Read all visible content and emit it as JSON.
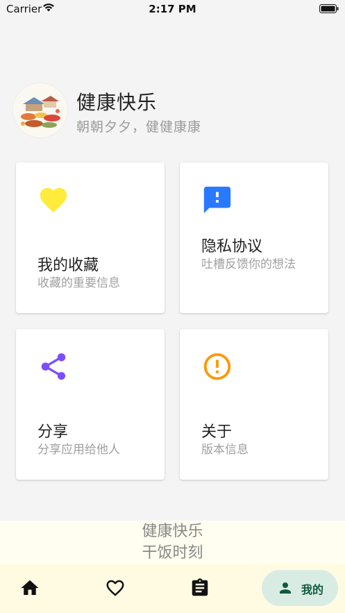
{
  "status_bar": {
    "carrier": "Carrier",
    "time": "2:17 PM"
  },
  "profile": {
    "name": "健康快乐",
    "subtitle": "朝朝夕夕，健健康康"
  },
  "cards": [
    {
      "title": "我的收藏",
      "desc": "收藏的重要信息",
      "icon": "heart-icon",
      "color": "#FFEB3B"
    },
    {
      "title": "隐私协议",
      "desc": "吐槽反馈你的想法",
      "icon": "feedback-icon",
      "color": "#2979FF"
    },
    {
      "title": "分享",
      "desc": "分享应用给他人",
      "icon": "share-icon",
      "color": "#7C4DFF"
    },
    {
      "title": "关于",
      "desc": "版本信息",
      "icon": "info-icon",
      "color": "#FF9800"
    }
  ],
  "footer": {
    "line1": "健康快乐",
    "line2": "干饭时刻"
  },
  "nav": {
    "home_icon": "home-icon",
    "favorite_icon": "heart-outline-icon",
    "clipboard_icon": "clipboard-icon",
    "mine_label": "我的"
  }
}
